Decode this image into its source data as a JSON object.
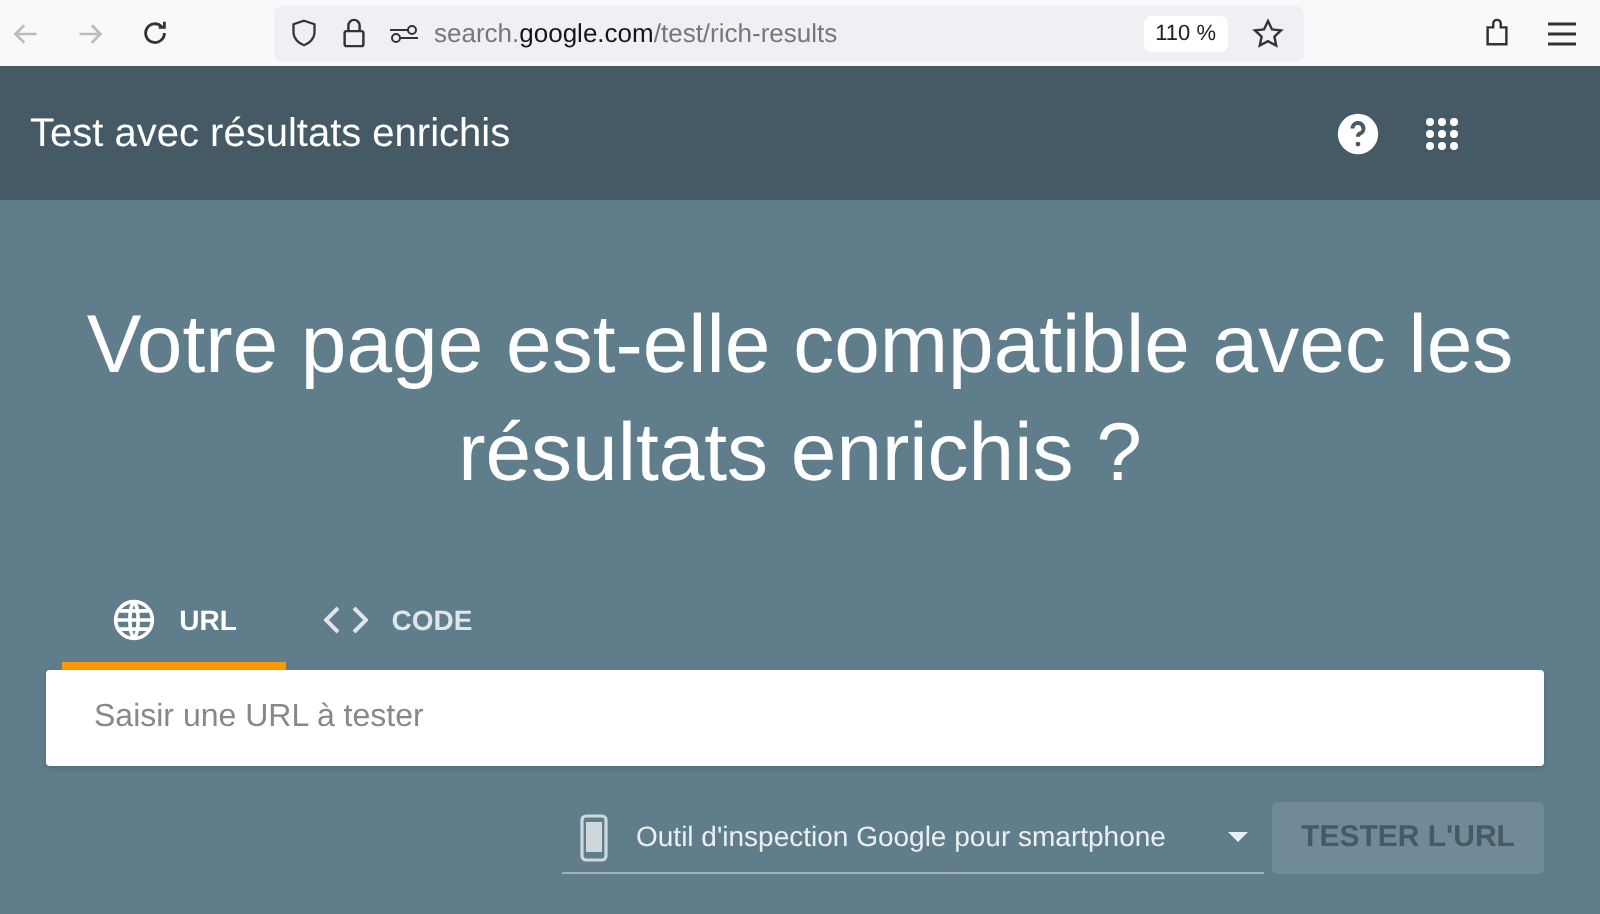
{
  "browser": {
    "url_parts": [
      {
        "text": "search.",
        "emphasis": false
      },
      {
        "text": "google.com",
        "emphasis": true
      },
      {
        "text": "/test/rich-results",
        "emphasis": false
      }
    ],
    "zoom": "110 %"
  },
  "header": {
    "title": "Test avec résultats enrichis"
  },
  "headline": "Votre page est-elle compatible avec les résultats enrichis ?",
  "tabs": [
    {
      "label": "URL",
      "kind": "globe",
      "selected": true
    },
    {
      "label": "CODE",
      "kind": "code",
      "selected": false
    }
  ],
  "url_field": {
    "placeholder": "Saisir une URL à tester"
  },
  "user_agent": {
    "value": "Outil d'inspection Google pour smartphone"
  },
  "test_button": {
    "label": "TESTER L'URL",
    "disabled": true
  }
}
